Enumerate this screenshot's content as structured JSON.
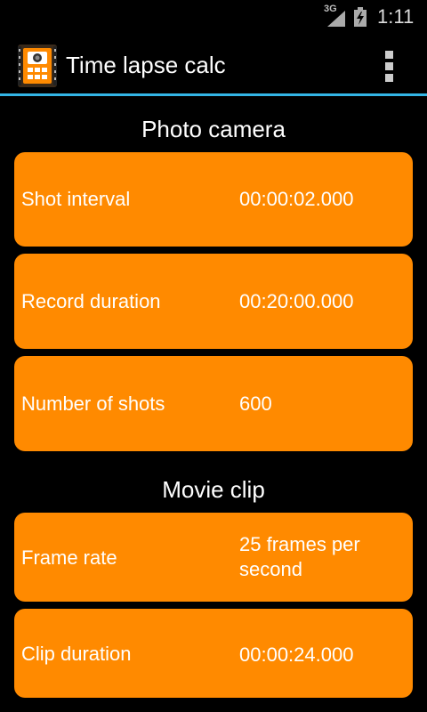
{
  "status_bar": {
    "network": "3G",
    "time": "1:11"
  },
  "app_bar": {
    "title": "Time lapse calc"
  },
  "photo_section": {
    "title": "Photo camera",
    "rows": [
      {
        "label": "Shot interval",
        "value": "00:00:02.000"
      },
      {
        "label": "Record duration",
        "value": "00:20:00.000"
      },
      {
        "label": "Number of shots",
        "value": "600"
      }
    ]
  },
  "movie_section": {
    "title": "Movie clip",
    "rows": [
      {
        "label": "Frame rate",
        "value": "25 frames per second"
      },
      {
        "label": "Clip duration",
        "value": "00:00:24.000"
      }
    ]
  },
  "colors": {
    "card": "#ff8a00",
    "accent": "#33b5e5",
    "background": "#000000"
  }
}
